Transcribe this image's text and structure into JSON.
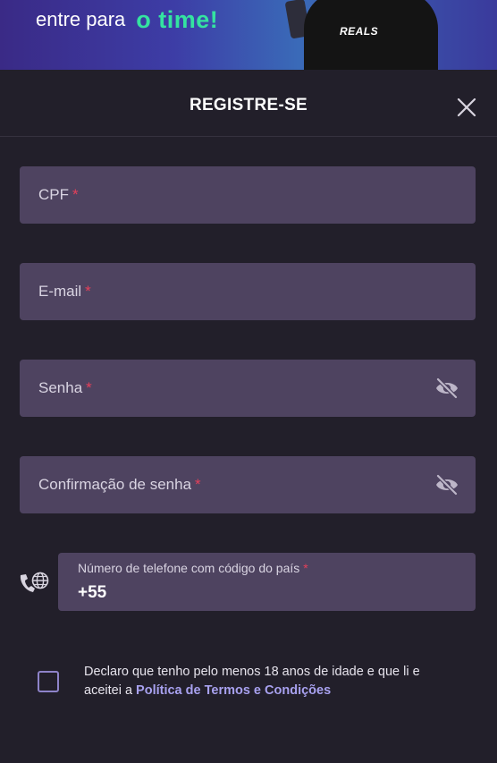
{
  "banner": {
    "lead_text": "entre para",
    "highlight_text": "o time!",
    "shirt_logo": "REALS"
  },
  "modal": {
    "title": "REGISTRE-SE"
  },
  "fields": {
    "cpf": {
      "label": "CPF",
      "required_mark": "*"
    },
    "email": {
      "label": "E-mail",
      "required_mark": "*"
    },
    "password": {
      "label": "Senha",
      "required_mark": "*"
    },
    "password_confirm": {
      "label": "Confirmação de senha",
      "required_mark": "*"
    },
    "phone": {
      "label": "Número de telefone com código do país",
      "required_mark": "*",
      "value": "+55"
    }
  },
  "consent": {
    "text": "Declaro que tenho pelo menos 18 anos de idade e que li e aceitei a ",
    "link_text": "Política de Termos e Condições",
    "checked": false
  },
  "colors": {
    "background": "#221f2a",
    "field_bg": "#4e4360",
    "required": "#e4405a",
    "link": "#a8a1ef",
    "banner_highlight": "#34e3a0"
  },
  "icons": {
    "close": "close-icon",
    "password_visibility": "eye-slash-icon",
    "phone_country": "phone-globe-icon"
  }
}
